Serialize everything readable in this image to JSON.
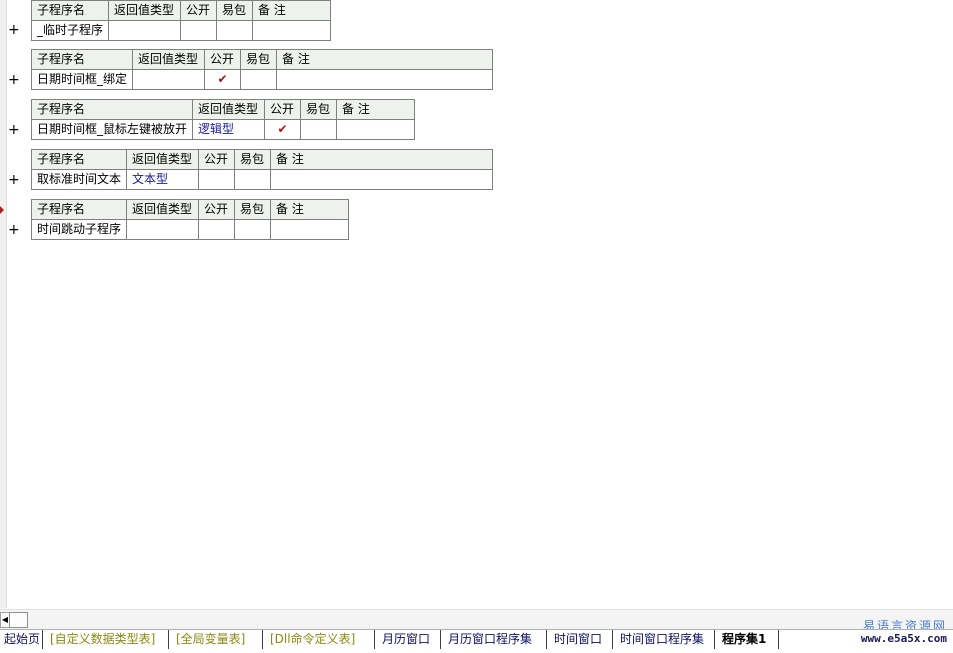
{
  "headers": {
    "name": "子程序名",
    "return_type": "返回值类型",
    "public": "公开",
    "easy_pack": "易包",
    "remark": "备 注"
  },
  "subroutines": [
    {
      "name": "_临时子程序",
      "return_type": "",
      "public": false,
      "easy_pack": false,
      "remark": ""
    },
    {
      "name": "日期时间框_绑定",
      "return_type": "",
      "public": true,
      "easy_pack": false,
      "remark": ""
    },
    {
      "name": "日期时间框_鼠标左键被放开",
      "return_type": "逻辑型",
      "public": true,
      "easy_pack": false,
      "remark": ""
    },
    {
      "name": "取标准时间文本",
      "return_type": "文本型",
      "public": false,
      "easy_pack": false,
      "remark": ""
    },
    {
      "name": "时间跳动子程序",
      "return_type": "",
      "public": false,
      "easy_pack": false,
      "remark": ""
    }
  ],
  "expand_symbol": "+",
  "check_symbol": "✔",
  "tabs": [
    {
      "label": "起始页",
      "style": "navy"
    },
    {
      "label": "[自定义数据类型表]",
      "style": "olive"
    },
    {
      "label": "[全局变量表]",
      "style": "olive"
    },
    {
      "label": "[Dll命令定义表]",
      "style": "olive"
    },
    {
      "label": "月历窗口",
      "style": "navy"
    },
    {
      "label": "月历窗口程序集",
      "style": "navy"
    },
    {
      "label": "时间窗口",
      "style": "navy"
    },
    {
      "label": "时间窗口程序集",
      "style": "navy"
    },
    {
      "label": "程序集1",
      "style": "active"
    }
  ],
  "watermark": {
    "site_name": "易语言资源网",
    "url": "www.e5a5x.com"
  },
  "colors": {
    "header_bg": "#eef2ec",
    "type_text": "#1a1aa0",
    "check": "#a01818"
  }
}
